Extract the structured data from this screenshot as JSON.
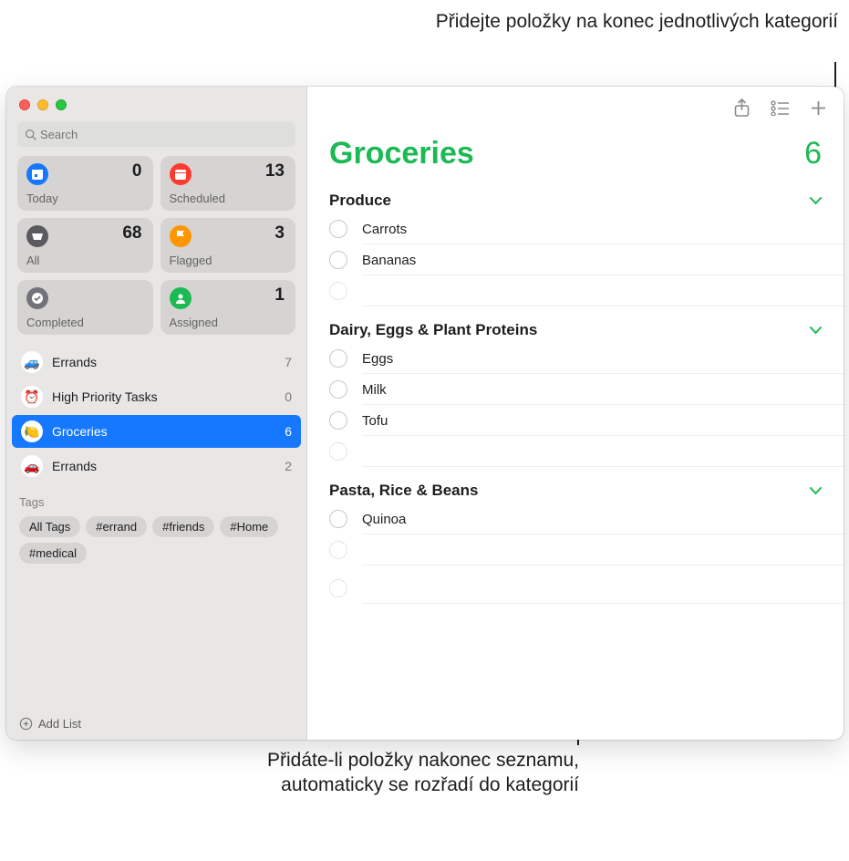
{
  "callouts": {
    "top": "Přidejte položky na konec jednotlivých kategorií",
    "bottom": "Přidáte-li položky nakonec seznamu, automaticky se rozřadí do kategorií"
  },
  "search": {
    "placeholder": "Search"
  },
  "smart": [
    {
      "key": "today",
      "label": "Today",
      "count": "0",
      "color": "#1677ff"
    },
    {
      "key": "scheduled",
      "label": "Scheduled",
      "count": "13",
      "color": "#ff3b30"
    },
    {
      "key": "all",
      "label": "All",
      "count": "68",
      "color": "#5b5b5f"
    },
    {
      "key": "flagged",
      "label": "Flagged",
      "count": "3",
      "color": "#ff9500"
    },
    {
      "key": "completed",
      "label": "Completed",
      "count": "",
      "color": "#72727a"
    },
    {
      "key": "assigned",
      "label": "Assigned",
      "count": "1",
      "color": "#1db954"
    }
  ],
  "lists": [
    {
      "name": "Errands",
      "count": "7",
      "emoji": "🚙",
      "selected": false
    },
    {
      "name": "High Priority Tasks",
      "count": "0",
      "emoji": "⏰",
      "selected": false
    },
    {
      "name": "Groceries",
      "count": "6",
      "emoji": "🍋",
      "selected": true
    },
    {
      "name": "Errands",
      "count": "2",
      "emoji": "🚗",
      "selected": false
    }
  ],
  "tags_title": "Tags",
  "tags": [
    "All Tags",
    "#errand",
    "#friends",
    "#Home",
    "#medical"
  ],
  "add_list": "Add List",
  "main": {
    "title": "Groceries",
    "count": "6",
    "sections": [
      {
        "title": "Produce",
        "items": [
          "Carrots",
          "Bananas"
        ]
      },
      {
        "title": "Dairy, Eggs & Plant Proteins",
        "items": [
          "Eggs",
          "Milk",
          "Tofu"
        ]
      },
      {
        "title": "Pasta, Rice & Beans",
        "items": [
          "Quinoa"
        ]
      }
    ]
  }
}
